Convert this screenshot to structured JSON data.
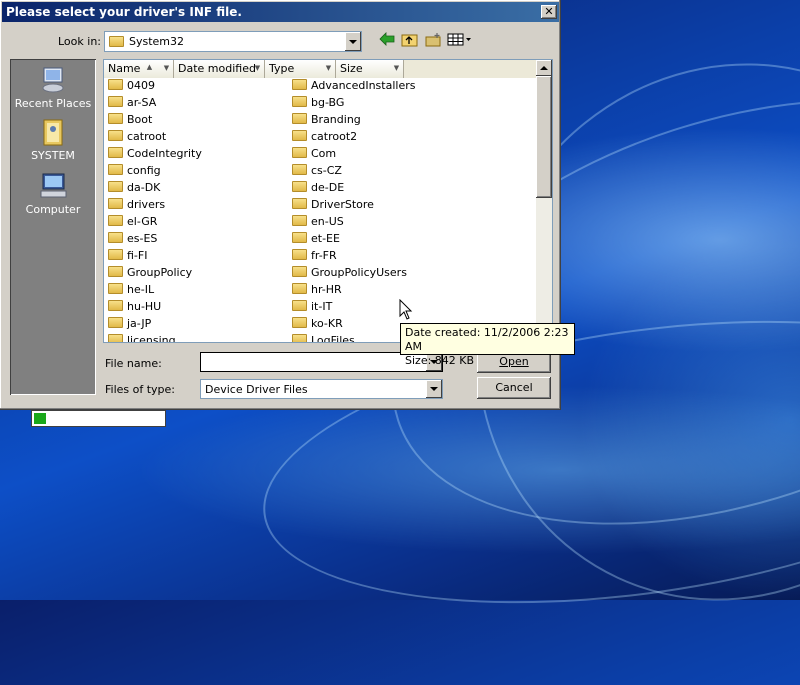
{
  "dialog": {
    "title": "Please select your driver's INF file.",
    "close_glyph": "✕"
  },
  "toolbar": {
    "look_in_label": "Look in:",
    "look_in_value": "System32",
    "back_icon": "back-arrow-icon",
    "up_icon": "up-folder-icon",
    "new_folder_icon": "new-folder-icon",
    "views_icon": "views-menu-icon"
  },
  "places": [
    {
      "label": "Recent Places",
      "icon": "recent-places-icon"
    },
    {
      "label": "SYSTEM",
      "icon": "user-folder-icon"
    },
    {
      "label": "Computer",
      "icon": "computer-icon"
    }
  ],
  "columns": [
    "Name",
    "Date modified",
    "Type",
    "Size"
  ],
  "files_col1": [
    "0409",
    "ar-SA",
    "Boot",
    "catroot",
    "CodeIntegrity",
    "config",
    "da-DK",
    "drivers",
    "el-GR",
    "es-ES",
    "fi-FI",
    "GroupPolicy",
    "he-IL",
    "hu-HU",
    "ja-JP",
    "licensing"
  ],
  "files_col2": [
    "AdvancedInstallers",
    "bg-BG",
    "Branding",
    "catroot2",
    "Com",
    "cs-CZ",
    "de-DE",
    "DriverStore",
    "en-US",
    "et-EE",
    "fr-FR",
    "GroupPolicyUsers",
    "hr-HR",
    "it-IT",
    "ko-KR",
    "LogFiles"
  ],
  "file_name": {
    "label": "File name:",
    "value": ""
  },
  "file_type": {
    "label": "Files of type:",
    "value": "Device Driver Files"
  },
  "buttons": {
    "open": "Open",
    "cancel": "Cancel"
  },
  "tooltip": {
    "line1": "Date created: 11/2/2006 2:23 AM",
    "line2": "Size: 842 KB"
  },
  "progress": {
    "fraction": 0.09,
    "color": "#1aa81a"
  }
}
